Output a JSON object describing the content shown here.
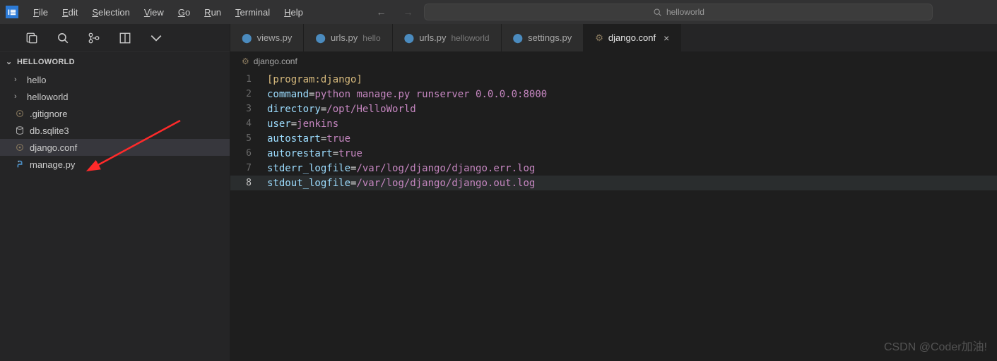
{
  "menu": {
    "file": "File",
    "edit": "Edit",
    "selection": "Selection",
    "view": "View",
    "go": "Go",
    "run": "Run",
    "terminal": "Terminal",
    "help": "Help"
  },
  "search": {
    "placeholder": "helloworld"
  },
  "explorer": {
    "title": "HELLOWORLD"
  },
  "tree": {
    "hello": "hello",
    "helloworld": "helloworld",
    "gitignore": ".gitignore",
    "dbsqlite": "db.sqlite3",
    "djangoconf": "django.conf",
    "managepy": "manage.py"
  },
  "tabs": {
    "views": "views.py",
    "urls1": "urls.py",
    "urls1_sfx": "hello",
    "urls2": "urls.py",
    "urls2_sfx": "helloworld",
    "settings": "settings.py",
    "django": "django.conf"
  },
  "breadcrumb": {
    "file": "django.conf"
  },
  "code": {
    "l1a": "[program:django]",
    "l2k": "command",
    "l2v": "python manage.py runserver 0.0.0.0:8000",
    "l3k": "directory",
    "l3v": "/opt/HelloWorld",
    "l4k": "user",
    "l4v": "jenkins",
    "l5k": "autostart",
    "l5v": "true",
    "l6k": "autorestart",
    "l6v": "true",
    "l7k": "stderr_logfile",
    "l7v": "/var/log/django/django.err.log",
    "l8k": "stdout_logfile",
    "l8v": "/var/log/django/django.out.log"
  },
  "line_numbers": {
    "1": "1",
    "2": "2",
    "3": "3",
    "4": "4",
    "5": "5",
    "6": "6",
    "7": "7",
    "8": "8"
  },
  "watermark": "CSDN @Coder加油!"
}
